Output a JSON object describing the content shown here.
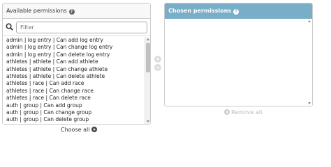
{
  "available": {
    "title": "Available permissions",
    "help_icon": "question-icon",
    "filter": {
      "placeholder": "Filter",
      "value": ""
    },
    "options": [
      "admin | log entry | Can add log entry",
      "admin | log entry | Can change log entry",
      "admin | log entry | Can delete log entry",
      "athletes | athlete | Can add athlete",
      "athletes | athlete | Can change athlete",
      "athletes | athlete | Can delete athlete",
      "athletes | race | Can add race",
      "athletes | race | Can change race",
      "athletes | race | Can delete race",
      "auth | group | Can add group",
      "auth | group | Can change group",
      "auth | group | Can delete group"
    ],
    "choose_all": "Choose all"
  },
  "chosen": {
    "title": "Chosen permissions",
    "help_icon": "question-icon",
    "options": [],
    "remove_all": "Remove all"
  },
  "colors": {
    "chosen_header_bg": "#79aec8",
    "panel_border": "#cccccc",
    "disabled_text": "#bbbbbb"
  },
  "icons": {
    "search": "search-icon",
    "add": "add-arrow-icon",
    "remove": "remove-arrow-icon",
    "choose_all": "choose-all-icon",
    "remove_all": "remove-all-icon"
  }
}
